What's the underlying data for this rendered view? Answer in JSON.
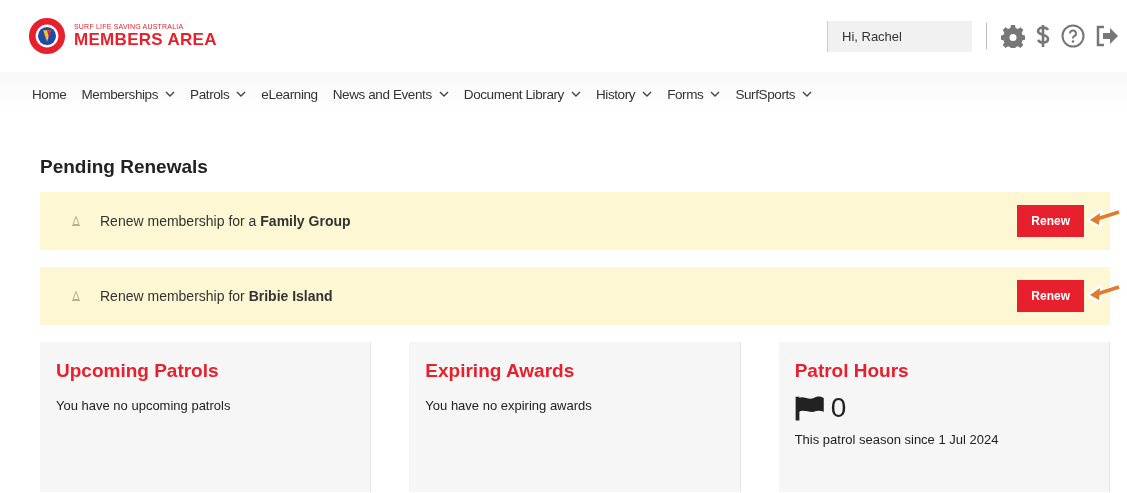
{
  "logo": {
    "org": "SURF LIFE SAVING AUSTRALIA",
    "title": "MEMBERS AREA"
  },
  "user": {
    "greeting": "Hi, Rachel"
  },
  "nav": [
    {
      "label": "Home",
      "dropdown": false
    },
    {
      "label": "Memberships",
      "dropdown": true
    },
    {
      "label": "Patrols",
      "dropdown": true
    },
    {
      "label": "eLearning",
      "dropdown": false
    },
    {
      "label": "News and Events",
      "dropdown": true
    },
    {
      "label": "Document Library",
      "dropdown": true
    },
    {
      "label": "History",
      "dropdown": true
    },
    {
      "label": "Forms",
      "dropdown": true
    },
    {
      "label": "SurfSports",
      "dropdown": true
    }
  ],
  "pending": {
    "title": "Pending Renewals",
    "items": [
      {
        "text": "Renew membership for a **Family Group**",
        "button": "Renew"
      },
      {
        "text": "Renew membership for **Bribie Island**",
        "button": "Renew"
      }
    ]
  },
  "cards": [
    {
      "kind": "text",
      "title": "Upcoming Patrols",
      "body": "You have no upcoming patrols"
    },
    {
      "kind": "text",
      "title": "Expiring Awards",
      "body": "You have no expiring awards"
    },
    {
      "kind": "hours",
      "title": "Patrol Hours",
      "value": "0",
      "body": "This patrol season since 1 Jul 2024"
    }
  ]
}
